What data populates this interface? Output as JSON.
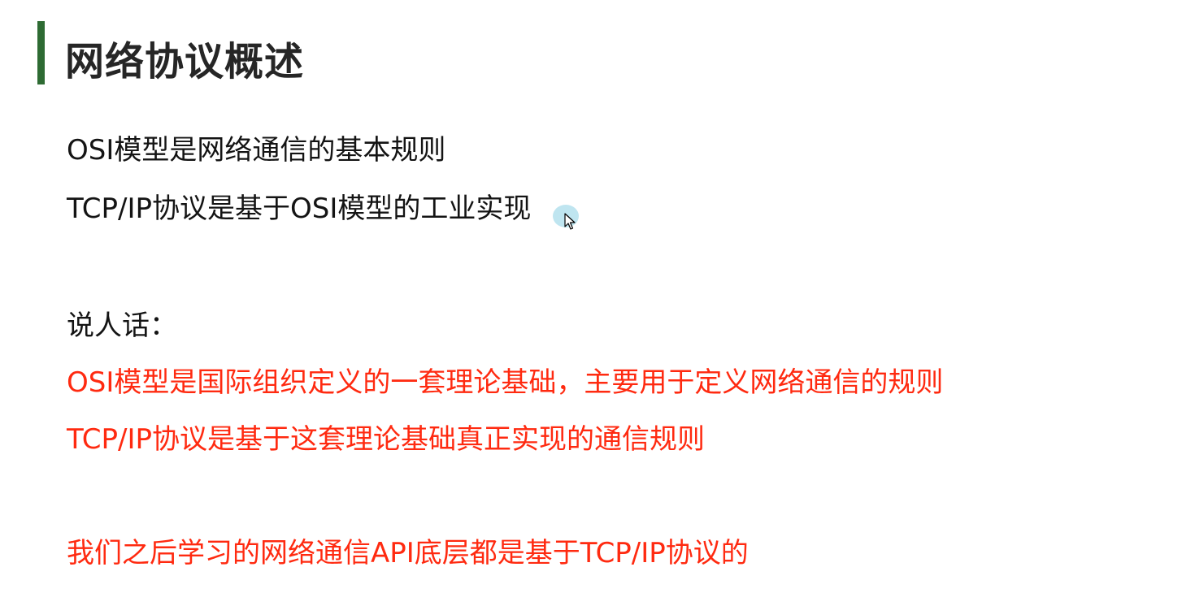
{
  "slide": {
    "title": "网络协议概述",
    "lines": [
      "OSI模型是网络通信的基本规则",
      "TCP/IP协议是基于OSI模型的工业实现",
      "说人话：",
      "OSI模型是国际组织定义的一套理论基础，主要用于定义网络通信的规则",
      "TCP/IP协议是基于这套理论基础真正实现的通信规则",
      "我们之后学习的网络通信API底层都是基于TCP/IP协议的"
    ]
  },
  "colors": {
    "accent_bar": "#2e6b33",
    "title_text": "#262626",
    "body_text": "#141414",
    "emphasis_text": "#ff2a10"
  },
  "icons": {
    "cursor": "mouse-pointer-icon"
  }
}
